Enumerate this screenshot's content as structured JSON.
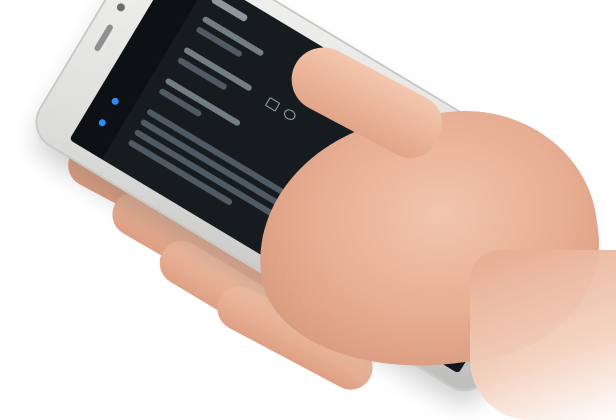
{
  "scene": {
    "subject": "hand-holding-smartphone",
    "colors": {
      "background": "#ffffff",
      "phone_frame": "#e6e6e4",
      "screen": "#161b20",
      "accent": "#3ea0ff",
      "skin": "#e8b095"
    },
    "icons": [
      "menu-icon",
      "calendar-icon",
      "document-icon",
      "printer-icon",
      "home-icon"
    ]
  }
}
